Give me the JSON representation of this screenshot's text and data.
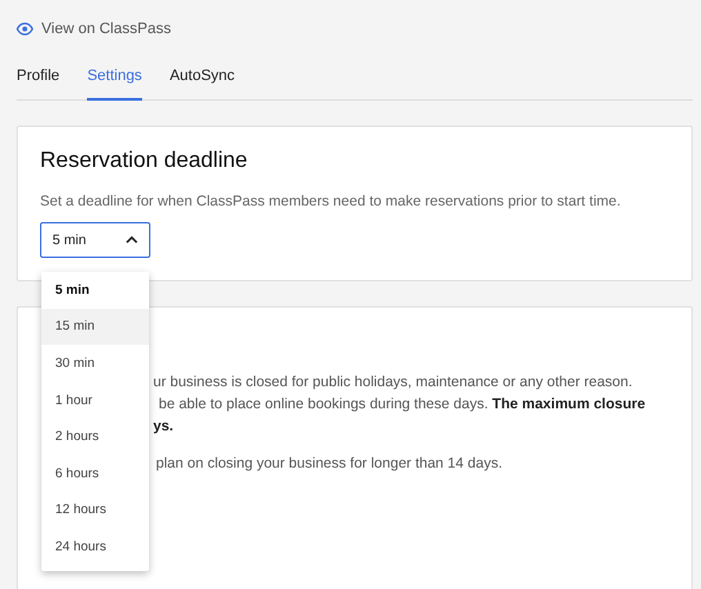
{
  "view_link": "View on ClassPass",
  "tabs": [
    {
      "label": "Profile",
      "selected": false
    },
    {
      "label": "Settings",
      "selected": true
    },
    {
      "label": "AutoSync",
      "selected": false
    }
  ],
  "reservation_card": {
    "title": "Reservation deadline",
    "description": "Set a deadline for when ClassPass members need to make reservations prior to start time.",
    "select": {
      "value": "5 min",
      "expanded": true
    }
  },
  "dropdown": {
    "options": [
      {
        "label": "5 min",
        "selected": true,
        "highlighted": false
      },
      {
        "label": "15 min",
        "selected": false,
        "highlighted": true
      },
      {
        "label": "30 min",
        "selected": false,
        "highlighted": false
      },
      {
        "label": "1 hour",
        "selected": false,
        "highlighted": false
      },
      {
        "label": "2 hours",
        "selected": false,
        "highlighted": false
      },
      {
        "label": "6 hours",
        "selected": false,
        "highlighted": false
      },
      {
        "label": "12 hours",
        "selected": false,
        "highlighted": false
      },
      {
        "label": "24 hours",
        "selected": false,
        "highlighted": false
      }
    ]
  },
  "closure_card": {
    "lines": [
      "ur business is closed for public holidays, maintenance or any other reason.",
      "be able to place online bookings during these days. **The maximum closure**",
      "**ys.**",
      "plan on closing your business for longer than 14 days."
    ]
  }
}
